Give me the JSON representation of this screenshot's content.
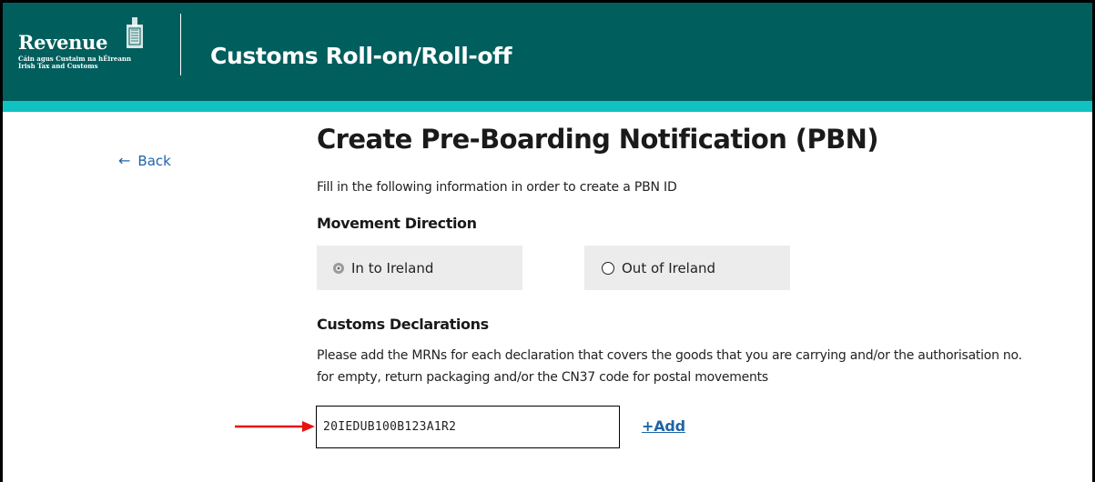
{
  "header": {
    "logo_word": "Revenue",
    "logo_sub_line1": "Cáin agus Custaim na hÉireann",
    "logo_sub_line2": "Irish Tax and Customs",
    "app_title": "Customs Roll-on/Roll-off"
  },
  "nav": {
    "back_label": "Back",
    "back_icon": "left-arrow-icon"
  },
  "page": {
    "title": "Create Pre-Boarding Notification (PBN)",
    "intro": "Fill in the following information in order to create a PBN ID"
  },
  "movement": {
    "label": "Movement Direction",
    "options": [
      {
        "label": "In to Ireland",
        "selected": true
      },
      {
        "label": "Out of Ireland",
        "selected": false
      }
    ]
  },
  "declarations": {
    "label": "Customs Declarations",
    "description": "Please add the MRNs for each declaration that covers the goods that you are carrying and/or the authorisation no. for empty, return packaging and/or the CN37 code for postal movements",
    "mrn_value": "20IEDUB100B123A1R2",
    "add_label": "+Add"
  },
  "colors": {
    "header_bg": "#005e5d",
    "header_stripe": "#11c2c2",
    "link": "#1e64a8",
    "annotation_arrow": "#e8130c"
  }
}
